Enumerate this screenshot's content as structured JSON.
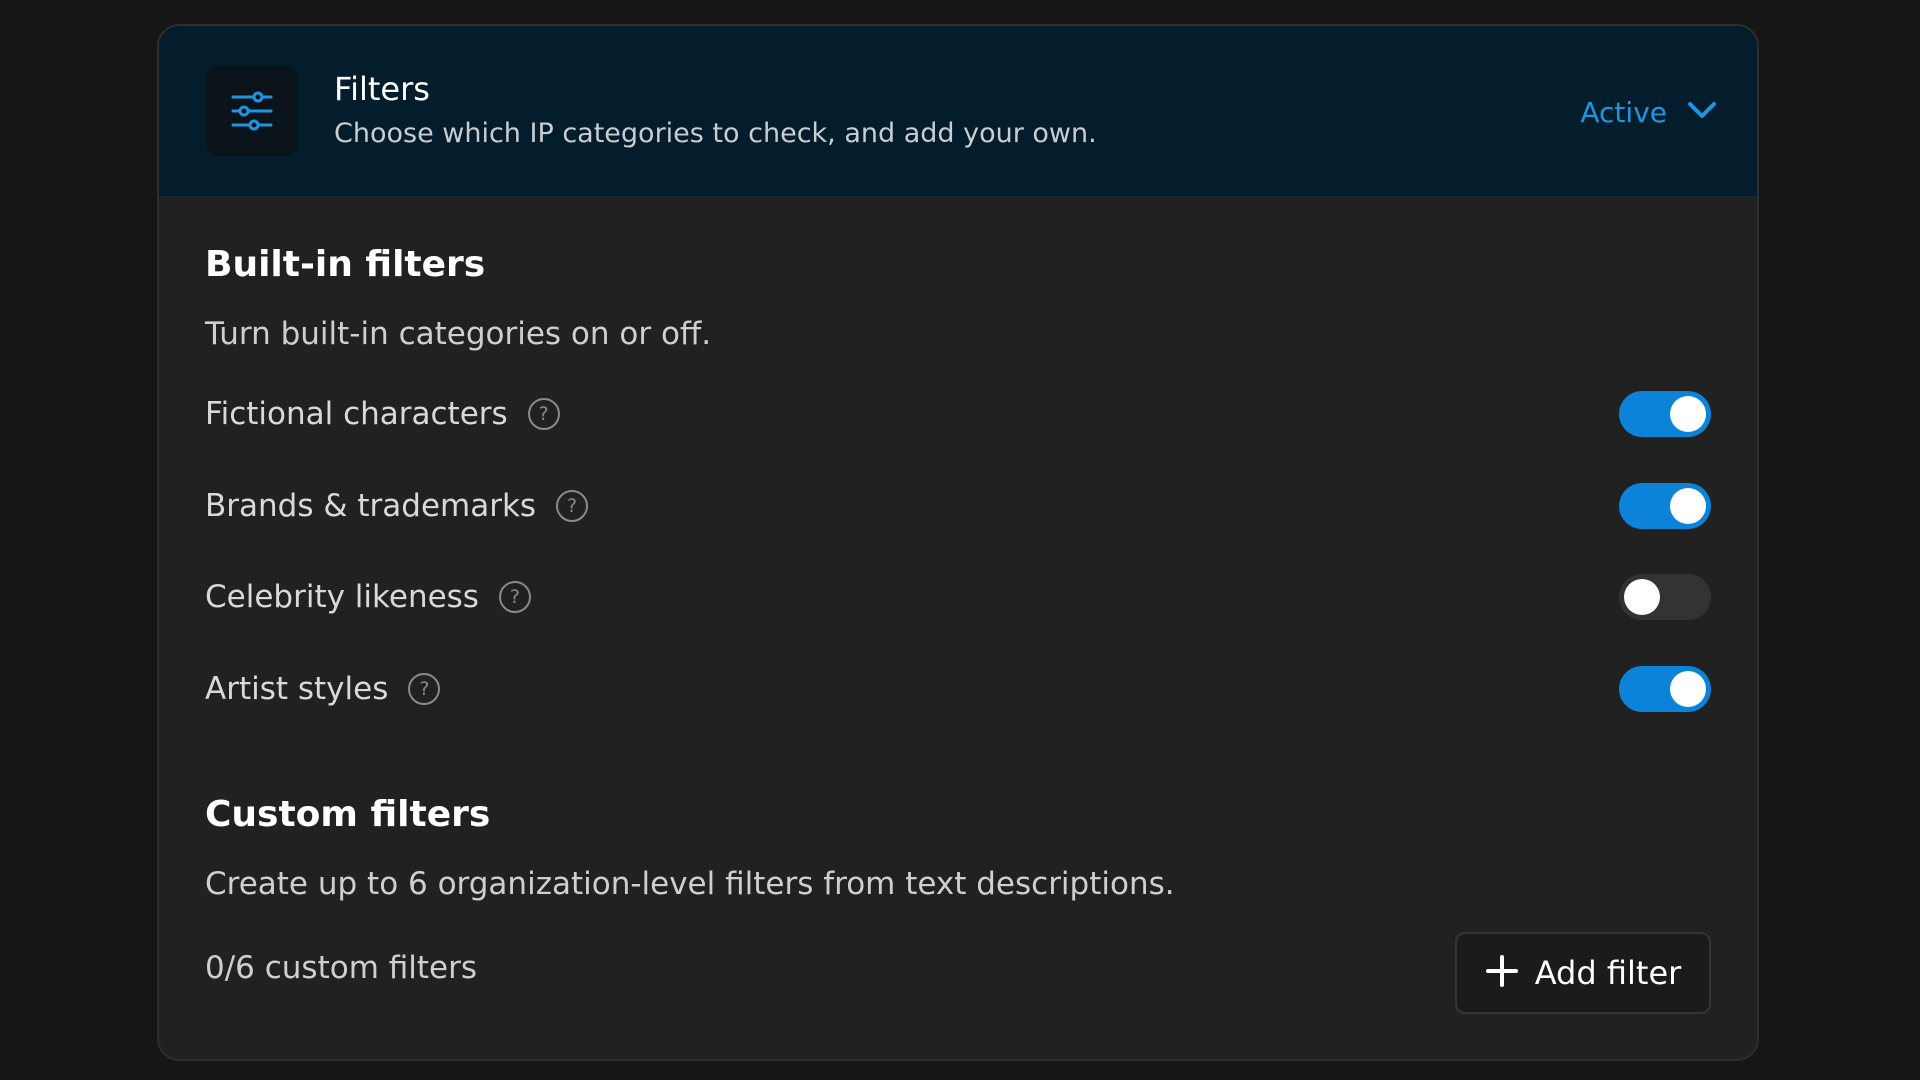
{
  "header": {
    "icon": "sliders-icon",
    "title": "Filters",
    "subtitle": "Choose which IP categories to check, and add your own.",
    "status_label": "Active",
    "status_color": "#1d96e0"
  },
  "builtin": {
    "title": "Built-in filters",
    "description": "Turn built-in categories on or off.",
    "items": [
      {
        "label": "Fictional characters",
        "enabled": true
      },
      {
        "label": "Brands & trademarks",
        "enabled": true
      },
      {
        "label": "Celebrity likeness",
        "enabled": false
      },
      {
        "label": "Artist styles",
        "enabled": true
      }
    ],
    "help_glyph": "?"
  },
  "custom": {
    "title": "Custom filters",
    "description": "Create up to 6 organization-level filters from text descriptions.",
    "count_label": "0/6 custom filters",
    "add_button_label": "Add filter"
  },
  "colors": {
    "toggle_on": "#0b83d9",
    "toggle_off": "#333333",
    "header_bg": "#041d2c",
    "card_bg": "#212121"
  }
}
